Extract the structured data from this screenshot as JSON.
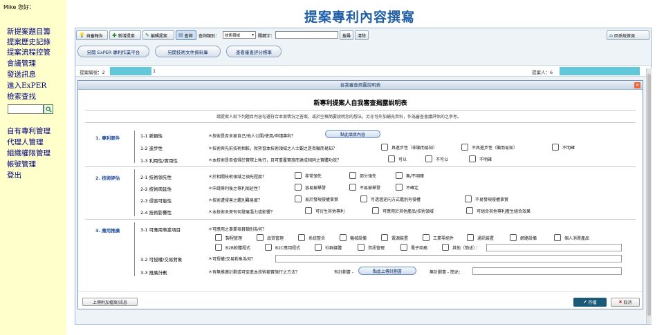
{
  "sidebar": {
    "greeting": "Mike 您好：",
    "links": [
      "新提案題目籌",
      "提案歷史記錄",
      "提案流程控管",
      "會議管理",
      "發送訊息",
      "進入ExPER",
      "檢索查找",
      "自有專利管理",
      "代理人管理",
      "組織權限管理",
      "帳號管理",
      "登出"
    ],
    "search_value": ""
  },
  "page": {
    "title": "提案專利內容撰寫"
  },
  "toolbar": {
    "buttons": [
      "自審報告",
      "新增提案",
      "編輯提案",
      "查詢"
    ],
    "query_type_label": "查詢類別：",
    "query_type_value": "技術領域",
    "keyword_label": "關鍵字：",
    "keyword_value": "",
    "search": "搜尋",
    "clear": "清除",
    "back_home": "回系統首頁"
  },
  "actions": {
    "open_exper": "另開 ExPER 專利作業平台",
    "open_tech_docs": "另開技術文件資料庫",
    "view_scoring": "查看審查評分標準"
  },
  "info": {
    "proposal_no_label": "提案編號：2",
    "proposal_no_tail": "1",
    "proposer_label": "提案人：6"
  },
  "dialog": {
    "title": "自我審查揭露說明表",
    "close": "×",
    "heading": "新專利提案人自我審查揭露說明表",
    "intro": "請提案人就下列題目內容勾選符合本案情況之答案，或於空格簡要說明您的想法，另亦可外加補充資料，作為審查會議評估的之參考。",
    "sections": [
      {
        "category": "1. 專利要件",
        "items": [
          {
            "label": "1-1 新穎性",
            "question": "＊技術是否未被自己/他人公開/使用/申請專利？",
            "action": "點此填寫內容",
            "options": []
          },
          {
            "label": "1-2 進步性",
            "question": "＊技術與先前技術相較，就熟習本技術領域之人士觀之是否顯而易知？",
            "options": [
              "具進步性（非顯而易知）",
              "不具進步性（顯而易知）",
              "不明確"
            ]
          },
          {
            "label": "1-3 利用性/實用性",
            "question": "＊本技術是否值得於實際上執行，且可重覆實施而達成相同之實體功效？",
            "options": [
              "可以",
              "不可以",
              "不明確"
            ]
          }
        ]
      },
      {
        "category": "2. 技術評估",
        "items": [
          {
            "label": "2-1 技術領先性",
            "question": "＊於相關技術領域之領先程度？",
            "options": [
              "非常領先",
              "部分領先",
              "無/不明確"
            ]
          },
          {
            "label": "2-2 技術周延性",
            "question": "＊申請專利後之專利周延性？",
            "options": [
              "容易被舉發",
              "不易被舉發",
              "不確定"
            ]
          },
          {
            "label": "2-3 侵害可能性",
            "question": "＊技術遭侵害之鑑別難易度？",
            "options": [
              "易於發現侵權事實",
              "可透過逆向方式鑑別有侵權",
              "不易發現侵權事實"
            ]
          },
          {
            "label": "2-4 技術影響性",
            "question": "＊本技術未來有何發展潛力或影響？",
            "options": [
              "可衍生其他專利",
              "可應用於其他產品/技術領域",
              "可組合其他專利產生組合效果"
            ]
          }
        ]
      },
      {
        "category": "3. 應用推廣",
        "items": [
          {
            "label": "3-1 可應用事業項目",
            "question": "＊可應用之事業項目類別為何？",
            "options_row1": [
              "製程管理",
              "品質管理",
              "系統整合",
              "機械設備",
              "電源裝置",
              "工業零組件",
              "通訊裝置",
              "網路設備",
              "個人消費產品"
            ],
            "options_row2": [
              "B2B軟體程式",
              "B2C應用程式",
              "社群媒體",
              "資訊管理",
              "電子商務",
              "其他（簡述）："
            ]
          },
          {
            "label": "3-2 可授權/交易對象",
            "question": "＊可授權/交易對象為何？",
            "options": []
          },
          {
            "label": "3-3 推廣計劃",
            "question": "＊有無推廣計劃或可促進本技術被實施行之方法？",
            "plan_label": "有計劃書 -",
            "plan_action": "點此上傳計劃書",
            "no_plan_label": "無計劃書 - 簡述："
          }
        ]
      }
    ],
    "footer": {
      "upload": "上傳附加檔案/訊息",
      "ok": "存檔",
      "cancel": "取消"
    }
  },
  "colors": {
    "sidebar_bg": "#ffffcc",
    "title": "#1f5fa8",
    "mask": "#60c8d8",
    "ok_btn": "#1a5a78"
  }
}
